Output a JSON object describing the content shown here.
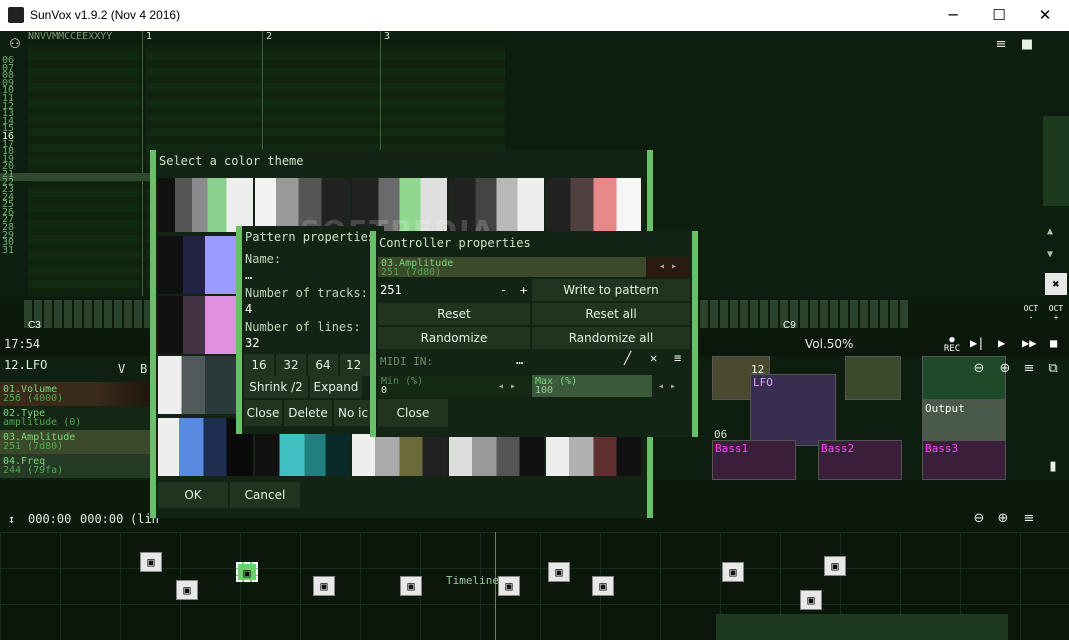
{
  "window": {
    "title": "SunVox v1.9.2 (Nov  4 2016)",
    "minimize": "─",
    "maximize": "☐",
    "close": "✕"
  },
  "pattern": {
    "header": "NNVVMMCCEEXXYY",
    "tracks": [
      "1",
      "2",
      "3"
    ],
    "rows": [
      "06",
      "07",
      "08",
      "09",
      "10",
      "11",
      "12",
      "13",
      "14",
      "15",
      "16",
      "17",
      "18",
      "19",
      "20",
      "21",
      "22",
      "23",
      "24",
      "25",
      "26",
      "27",
      "28",
      "29",
      "30",
      "31"
    ],
    "highlight_row": "16"
  },
  "toolbar": {
    "menu_icon": "≡",
    "lock_icon": "🔒",
    "oct_minus": "OCT -",
    "oct_plus": "OCT +"
  },
  "keyboard": {
    "left_octave": "C3",
    "right_octave": "C9"
  },
  "status": {
    "time": "17:54",
    "volume": "Vol.50%",
    "rec": "REC"
  },
  "module_panel": {
    "name": "12.LFO",
    "v_label": "V",
    "b_label": "B",
    "controllers": [
      {
        "name": "01.Volume",
        "value": "256 (4000)"
      },
      {
        "name": "02.Type",
        "value": "amplitude (0)"
      },
      {
        "name": "03.Amplitude",
        "value": "251 (7d80)"
      },
      {
        "name": "04.Freq",
        "value": "244 (79fa)"
      }
    ]
  },
  "network": {
    "modules": [
      {
        "name": "12",
        "color": "#3a2e50"
      },
      {
        "name": "LFO",
        "color": "#3a2e50"
      },
      {
        "name": "Output",
        "color": "#4a5a4a"
      },
      {
        "name": "06",
        "color": "#2a3a2a"
      },
      {
        "name": "Bass1",
        "color": "#3a1e3a"
      },
      {
        "name": "Bass2",
        "color": "#3a1e3a"
      },
      {
        "name": "Bass3",
        "color": "#3a1e3a"
      }
    ]
  },
  "timeline": {
    "start": "000:00",
    "end": "000:00",
    "suffix": "(lin",
    "label": "Timeline:"
  },
  "color_theme_dialog": {
    "title": "Select a color theme",
    "ok": "OK",
    "cancel": "Cancel"
  },
  "pattern_props": {
    "title": "Pattern properties",
    "name_label": "Name:",
    "name_value": "…",
    "tracks_label": "Number of tracks:",
    "tracks_value": "4",
    "lines_label": "Number of lines:",
    "lines_value": "32",
    "line_presets": [
      "16",
      "32",
      "64",
      "12"
    ],
    "shrink": "Shrink /2",
    "expand": "Expand",
    "close": "Close",
    "delete": "Delete",
    "no_icon": "No ic"
  },
  "controller_props": {
    "title": "Controller properties",
    "ctl_name": "03.Amplitude",
    "ctl_value": "251 (7d80)",
    "number": "251",
    "minus": "-",
    "plus": "+",
    "write": "Write to pattern",
    "reset": "Reset",
    "reset_all": "Reset all",
    "randomize": "Randomize",
    "randomize_all": "Randomize all",
    "midi_label": "MIDI IN:",
    "midi_value": "…",
    "min_label": "Min (%)",
    "min_value": "0",
    "max_label": "Max (%)",
    "max_value": "100",
    "close": "Close"
  },
  "watermark": "SOFTPEDIA"
}
